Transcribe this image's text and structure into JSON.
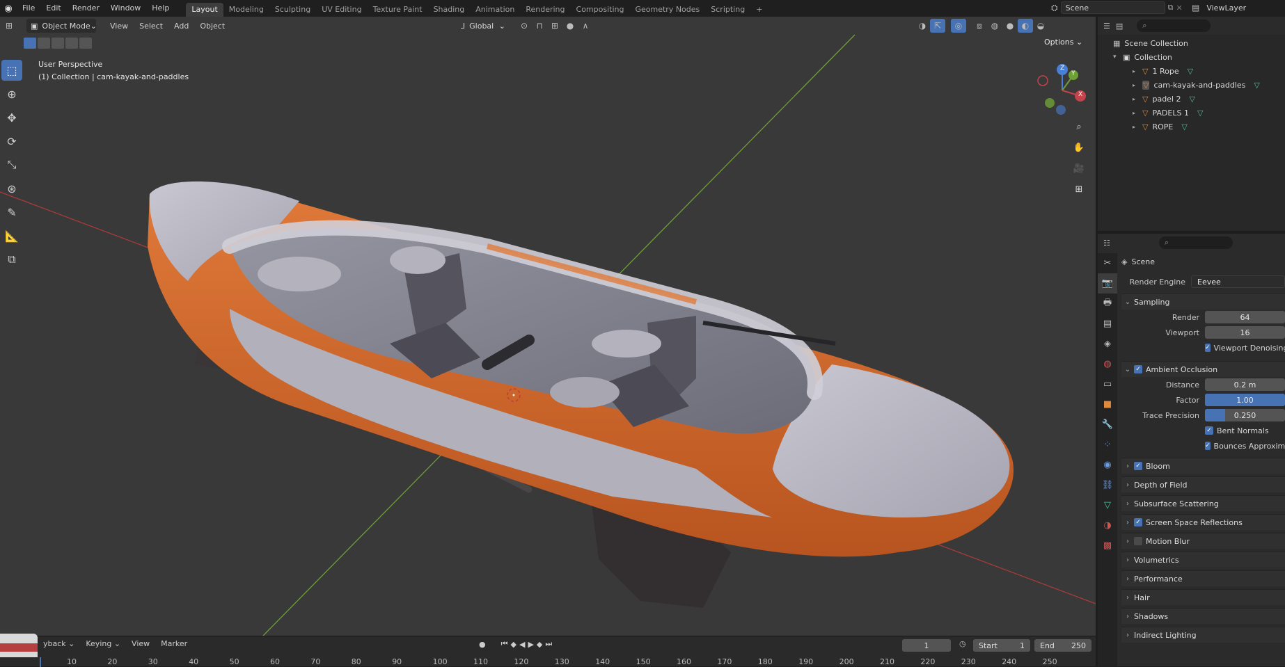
{
  "topbar": {
    "menus": [
      "File",
      "Edit",
      "Render",
      "Window",
      "Help"
    ],
    "workspace_tabs": [
      "Layout",
      "Modeling",
      "Sculpting",
      "UV Editing",
      "Texture Paint",
      "Shading",
      "Animation",
      "Rendering",
      "Compositing",
      "Geometry Nodes",
      "Scripting"
    ],
    "active_tab": "Layout",
    "scene_label": "Scene",
    "viewlayer_label": "ViewLayer"
  },
  "viewport_header": {
    "mode": "Object Mode",
    "menus": [
      "View",
      "Select",
      "Add",
      "Object"
    ],
    "transform_orientation": "Global",
    "options_label": "Options"
  },
  "viewport": {
    "perspective_label": "User Perspective",
    "collection_label": "(1) Collection | cam-kayak-and-paddles",
    "gizmo_axes": {
      "z": "Z",
      "y": "Y",
      "x": "X"
    }
  },
  "timeline": {
    "menus": [
      "yback",
      "Keying",
      "View",
      "Marker"
    ],
    "current_frame": "1",
    "start_label": "Start",
    "start_value": "1",
    "end_label": "End",
    "end_value": "250",
    "ruler": [
      "10",
      "20",
      "30",
      "40",
      "50",
      "60",
      "70",
      "80",
      "90",
      "100",
      "110",
      "120",
      "130",
      "140",
      "150",
      "160",
      "170",
      "180",
      "190",
      "200",
      "210",
      "220",
      "230",
      "240",
      "250"
    ]
  },
  "outliner": {
    "scene_collection": "Scene Collection",
    "collection": "Collection",
    "items": [
      "1 Rope",
      "cam-kayak-and-paddles",
      "padel 2",
      "PADELS 1",
      "ROPE"
    ]
  },
  "properties": {
    "scene_title": "Scene",
    "render_engine_label": "Render Engine",
    "render_engine_value": "Eevee",
    "sampling": {
      "title": "Sampling",
      "render_label": "Render",
      "render_value": "64",
      "viewport_label": "Viewport",
      "viewport_value": "16",
      "denoise_label": "Viewport Denoising"
    },
    "ao": {
      "title": "Ambient Occlusion",
      "distance_label": "Distance",
      "distance_value": "0.2 m",
      "factor_label": "Factor",
      "factor_value": "1.00",
      "factor_fill": 1.0,
      "trace_label": "Trace Precision",
      "trace_value": "0.250",
      "trace_fill": 0.25,
      "bent_label": "Bent Normals",
      "bounces_label": "Bounces Approximat"
    },
    "panels": [
      {
        "label": "Bloom",
        "checkbox": true,
        "checked": true
      },
      {
        "label": "Depth of Field",
        "checkbox": false,
        "checked": false
      },
      {
        "label": "Subsurface Scattering",
        "checkbox": false,
        "checked": false
      },
      {
        "label": "Screen Space Reflections",
        "checkbox": true,
        "checked": true
      },
      {
        "label": "Motion Blur",
        "checkbox": true,
        "checked": false
      },
      {
        "label": "Volumetrics",
        "checkbox": false,
        "checked": false
      },
      {
        "label": "Performance",
        "checkbox": false,
        "checked": false
      },
      {
        "label": "Hair",
        "checkbox": false,
        "checked": false
      },
      {
        "label": "Shadows",
        "checkbox": false,
        "checked": false
      },
      {
        "label": "Indirect Lighting",
        "checkbox": false,
        "checked": false
      }
    ]
  },
  "colors": {
    "accent": "#4772b3",
    "x_axis": "#a83b3b",
    "y_axis": "#6fa035",
    "kayak_orange": "#d66a2a",
    "kayak_grey": "#b9b8c2"
  }
}
